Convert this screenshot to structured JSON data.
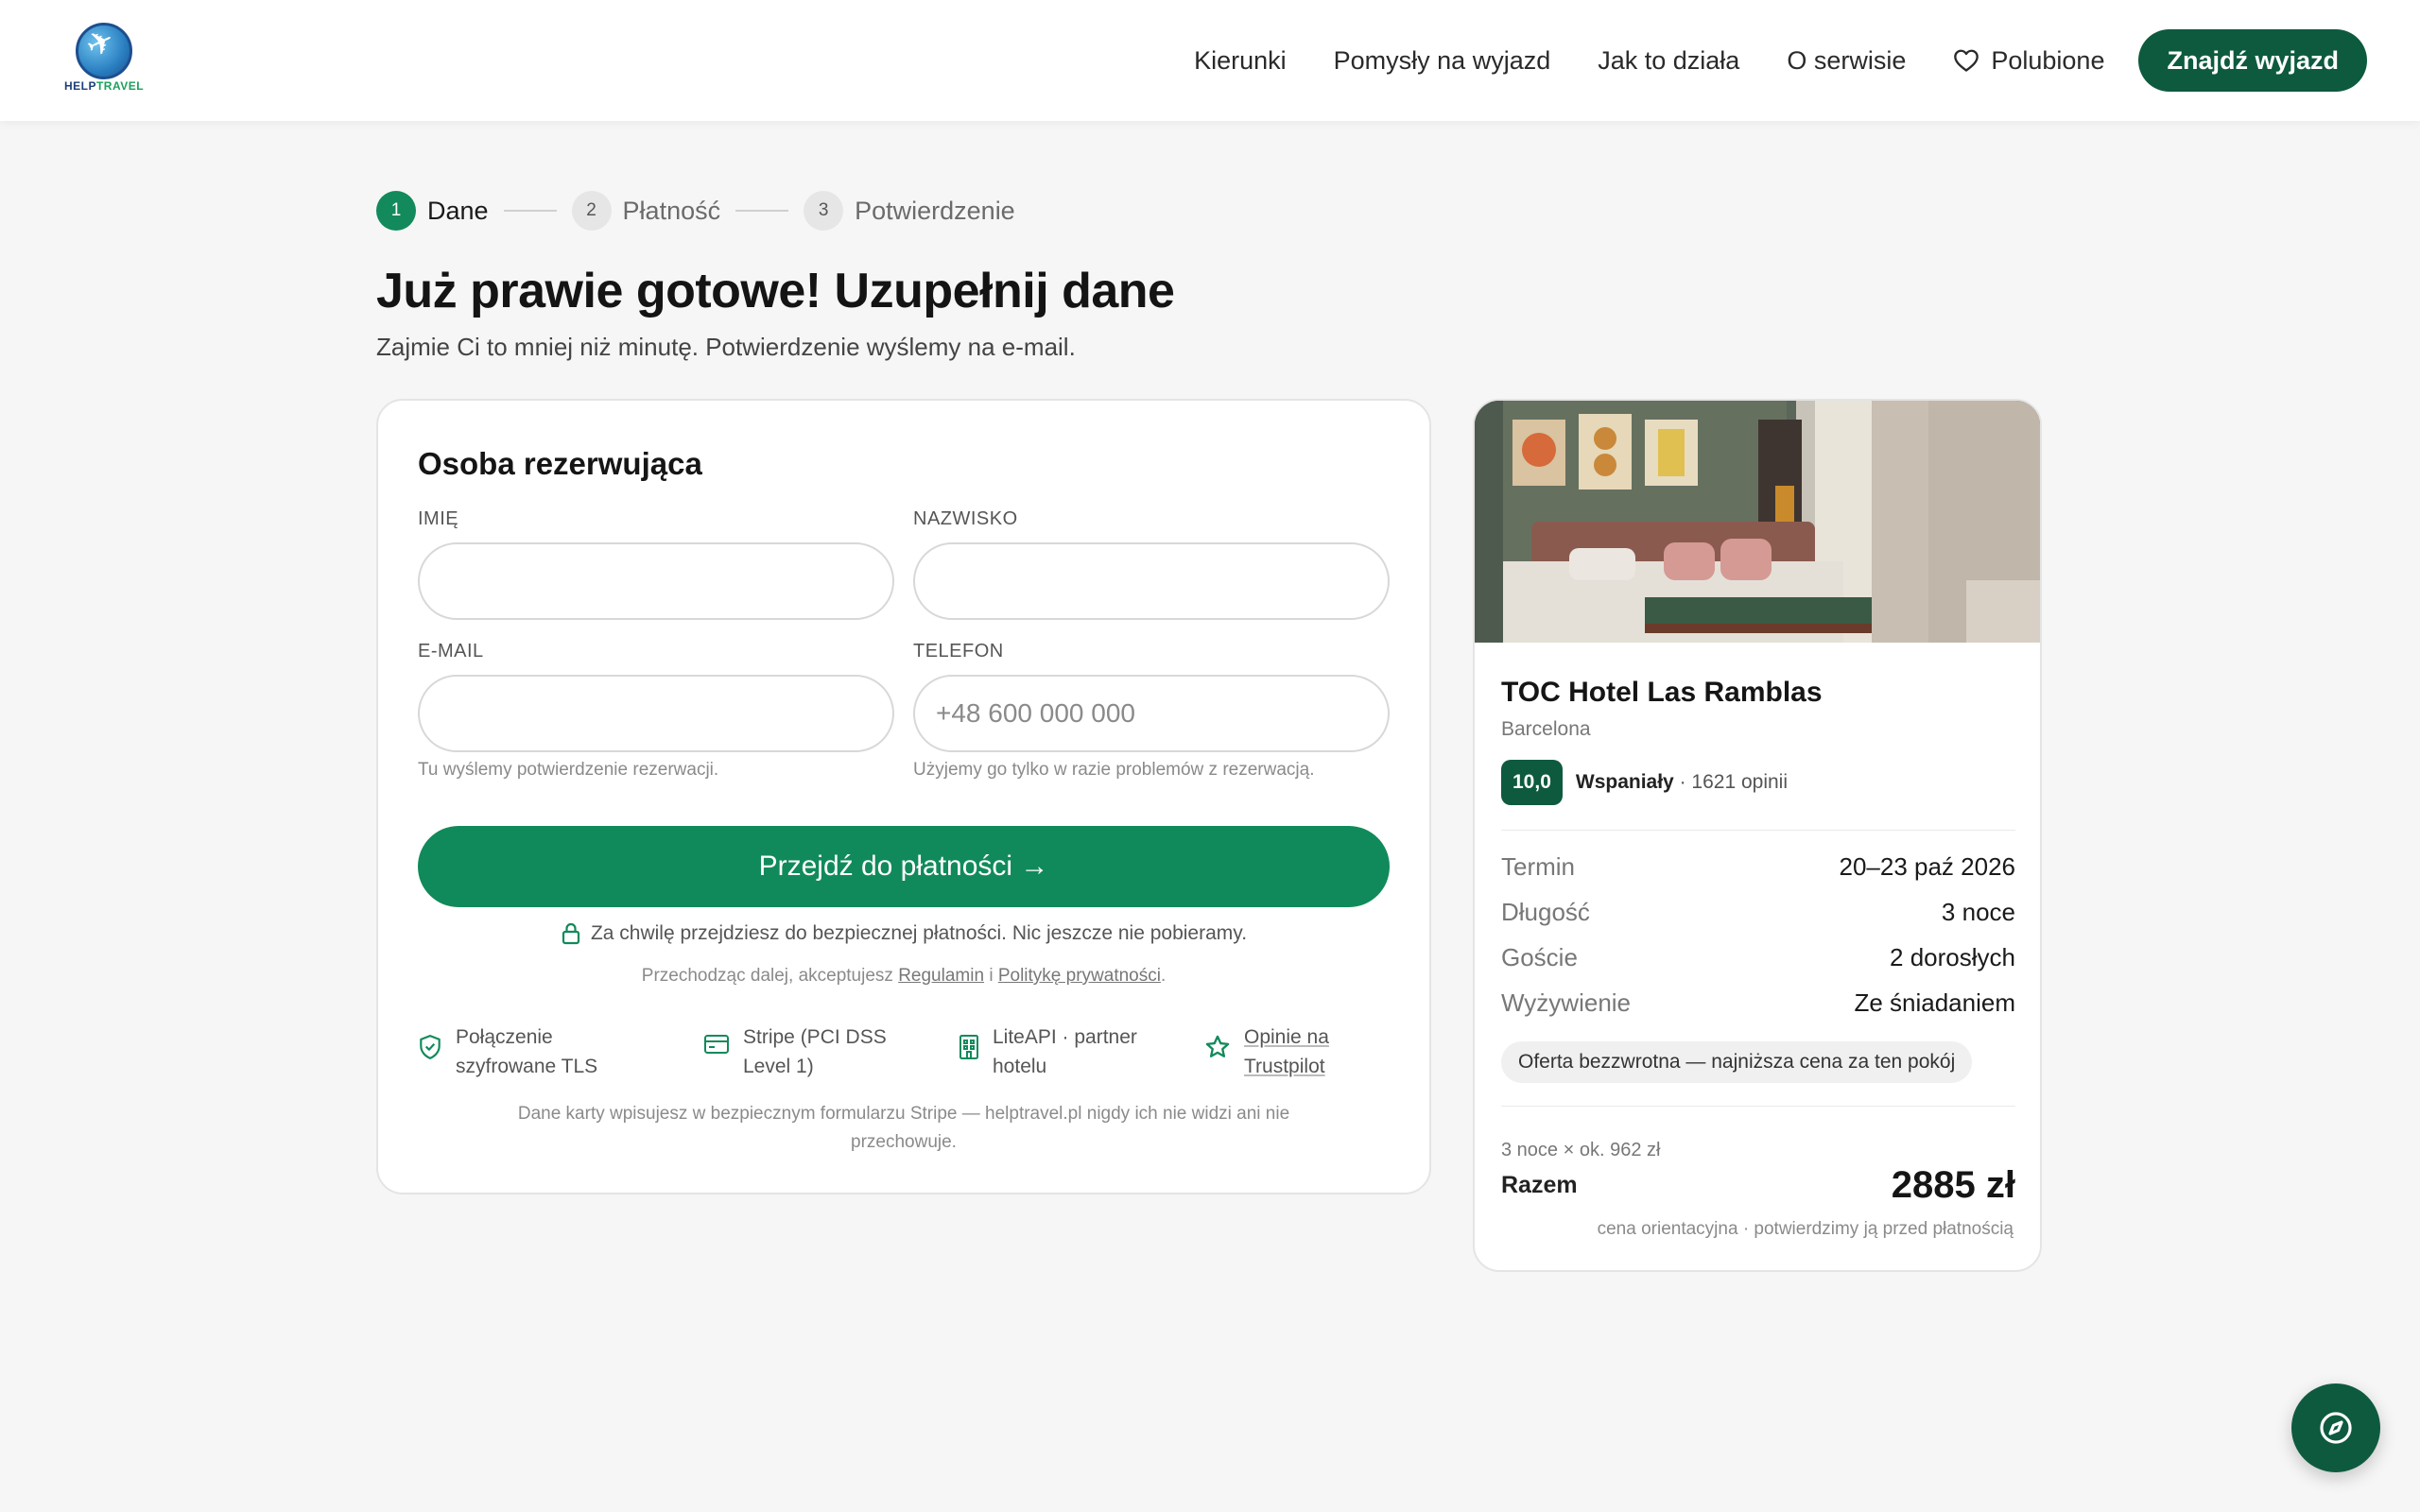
{
  "brand": {
    "logo_word_a": "HELP",
    "logo_word_b": "TRAVEL",
    "accent": "#118a5b",
    "dark_green": "#0e5a3f"
  },
  "nav": {
    "items": [
      "Kierunki",
      "Pomysły na wyjazd",
      "Jak to działa",
      "O serwisie"
    ],
    "favorites": "Polubione",
    "cta": "Znajdź wyjazd"
  },
  "stepper": [
    {
      "num": "1",
      "label": "Dane",
      "state": "active"
    },
    {
      "num": "2",
      "label": "Płatność",
      "state": "inactive"
    },
    {
      "num": "3",
      "label": "Potwierdzenie",
      "state": "inactive"
    }
  ],
  "page": {
    "title": "Już prawie gotowe! Uzupełnij dane",
    "subtitle": "Zajmie Ci to mniej niż minutę. Potwierdzenie wyślemy na e-mail."
  },
  "form": {
    "title": "Osoba rezerwująca",
    "first_name": {
      "label": "IMIĘ",
      "value": "",
      "placeholder": ""
    },
    "last_name": {
      "label": "NAZWISKO",
      "value": "",
      "placeholder": ""
    },
    "email": {
      "label": "E-MAIL",
      "value": "",
      "placeholder": "",
      "help": "Tu wyślemy potwierdzenie rezerwacji."
    },
    "phone": {
      "label": "TELEFON",
      "value": "",
      "placeholder": "+48 600 000 000",
      "help": "Użyjemy go tylko w razie problemów z rezerwacją."
    },
    "submit": "Przejdź do płatności →",
    "secure_note": "Za chwilę przejdziesz do bezpiecznej płatności. Nic jeszcze nie pobieramy.",
    "terms_prefix": "Przechodząc dalej, akceptujesz",
    "terms_link": "Regulamin",
    "terms_and": "i",
    "privacy_link": "Politykę prywatności",
    "terms_suffix": ".",
    "trust": [
      {
        "icon": "shield-check-icon",
        "line1": "Połączenie",
        "line2": "szyfrowane TLS"
      },
      {
        "icon": "credit-card-icon",
        "line1": "Stripe (PCI DSS",
        "line2": "Level 1)"
      },
      {
        "icon": "building-icon",
        "line1": "LiteAPI · partner",
        "line2": "hotelu"
      },
      {
        "icon": "star-icon",
        "line1": "Opinie na",
        "line2": "Trustpilot"
      }
    ],
    "stripe_note": "Dane karty wpisujesz w bezpiecznym formularzu Stripe — helptravel.pl nigdy ich nie widzi ani nie przechowuje."
  },
  "summary": {
    "hotel_name": "TOC Hotel Las Ramblas",
    "city": "Barcelona",
    "rating": "10,0",
    "rating_word": "Wspaniały",
    "reviews": "· 1621 opinii",
    "details": [
      {
        "key": "Termin",
        "value": "20–23 paź 2026"
      },
      {
        "key": "Długość",
        "value": "3 noce"
      },
      {
        "key": "Goście",
        "value": "2 dorosłych"
      },
      {
        "key": "Wyżywienie",
        "value": "Ze śniadaniem"
      }
    ],
    "offer": "Oferta bezzwrotna — najniższa cena za ten pokój",
    "calc": "3 noce × ok. 962 zł",
    "total_label": "Razem",
    "total_value": "2885 zł",
    "total_note": "cena orientacyjna · potwierdzimy ją przed płatnością"
  }
}
